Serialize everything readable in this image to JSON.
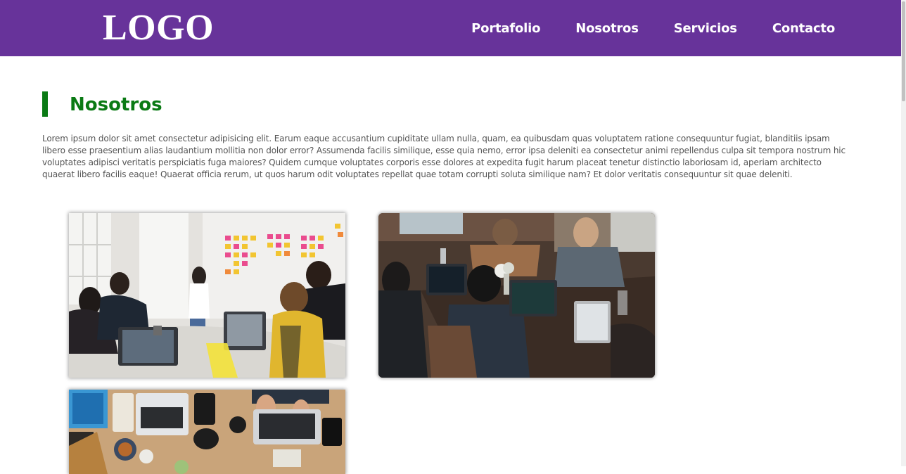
{
  "header": {
    "logo": "LOGO",
    "nav": [
      "Portafolio",
      "Nosotros",
      "Servicios",
      "Contacto"
    ]
  },
  "section": {
    "title": "Nosotros",
    "text": "Lorem ipsum dolor sit amet consectetur adipisicing elit. Earum eaque accusantium cupiditate ullam nulla, quam, ea quibusdam quas voluptatem ratione consequuntur fugiat, blanditiis ipsam libero esse praesentium alias laudantium mollitia non dolor error? Assumenda facilis similique, esse quia nemo, error ipsa deleniti ea consectetur animi repellendus culpa sit tempora nostrum hic voluptates adipisci veritatis perspiciatis fuga maiores? Quidem cumque voluptates corporis esse dolores at expedita fugit harum placeat tenetur distinctio laboriosam id, aperiam architecto quaerat libero facilis eaque! Quaerat officia rerum, ut quos harum odit voluptates repellat quae totam corrupti soluta similique nam? Et dolor veritatis consequuntur sit quae deleniti."
  },
  "colors": {
    "header_bg": "#67339a",
    "title_green": "#0a7a14",
    "body_text": "#555555"
  },
  "gallery": [
    {
      "name": "team-meeting-photo"
    },
    {
      "name": "team-laptops-photo"
    },
    {
      "name": "desk-top-view-photo"
    }
  ]
}
